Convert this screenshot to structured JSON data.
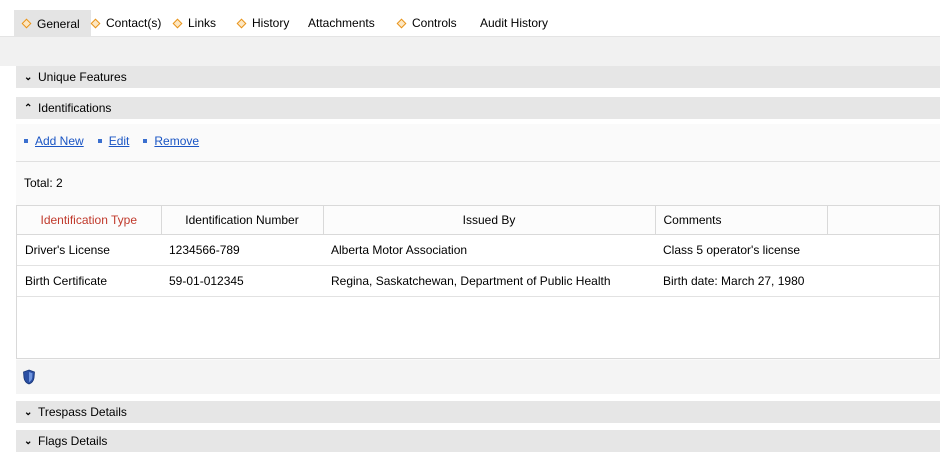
{
  "tabs": [
    {
      "label": "General",
      "marked": true
    },
    {
      "label": "Contact(s)",
      "marked": true
    },
    {
      "label": "Links",
      "marked": true
    },
    {
      "label": "History",
      "marked": true
    },
    {
      "label": "Attachments",
      "marked": false
    },
    {
      "label": "Controls",
      "marked": true
    },
    {
      "label": "Audit History",
      "marked": false
    }
  ],
  "sections": {
    "unique_features": "Unique Features",
    "identifications": "Identifications",
    "trespass_details": "Trespass Details",
    "flags_details": "Flags Details"
  },
  "actions": {
    "add_new": "Add New",
    "edit": "Edit",
    "remove": "Remove"
  },
  "total": "Total: 2",
  "table": {
    "headers": [
      "Identification Type",
      "Identification Number",
      "Issued By",
      "Comments"
    ],
    "rows": [
      [
        "Driver's License",
        "1234566-789",
        "Alberta Motor Association",
        "Class 5 operator's license"
      ],
      [
        "Birth Certificate",
        "59-01-012345",
        "Regina, Saskatchewan, Department of Public Health",
        "Birth date: March 27, 1980"
      ]
    ]
  },
  "colors": {
    "tab_marker": "#e8941c",
    "link": "#1a55c4",
    "sorted_header": "#c0392b"
  },
  "icons": {
    "shield": "shield-icon",
    "collapsed": "chevron-down-icon",
    "expanded": "chevron-up-icon"
  }
}
